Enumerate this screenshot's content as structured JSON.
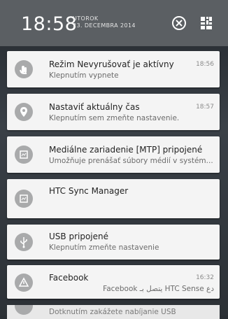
{
  "status": {
    "time": "18:58",
    "day": "UTOROK",
    "date": "23. DECEMBRA 2014"
  },
  "header_icons": {
    "clear": "clear-all-icon",
    "settings": "quick-settings-icon"
  },
  "notifications": [
    {
      "icon": "do-not-disturb-icon",
      "title": "Režim Nevyrušovať je aktívny",
      "subtitle": "Klepnutím vypnete",
      "time": "18:56"
    },
    {
      "icon": "location-pin-icon",
      "title": "Nastaviť aktuálny čas",
      "subtitle": "Klepnutím sem zmeňte nastavenie.",
      "time": "18:57"
    },
    {
      "icon": "media-device-icon",
      "title": "Mediálne zariadenie [MTP] pripojené",
      "subtitle": "Umožňuje prenášať súbory médií v systém..."
    },
    {
      "icon": "sync-icon",
      "title": "HTC Sync Manager"
    },
    {
      "icon": "usb-icon",
      "title": "USB pripojené",
      "subtitle": "Klepnutím zmeňte nastavenie"
    },
    {
      "icon": "facebook-icon",
      "title": "Facebook",
      "subtitle": "دع HTC Sense يتصل بـ Facebook",
      "time": "16:32"
    },
    {
      "icon": "charging-icon",
      "subtitle": "Dotknutím zakážete nabíjanie USB"
    }
  ]
}
